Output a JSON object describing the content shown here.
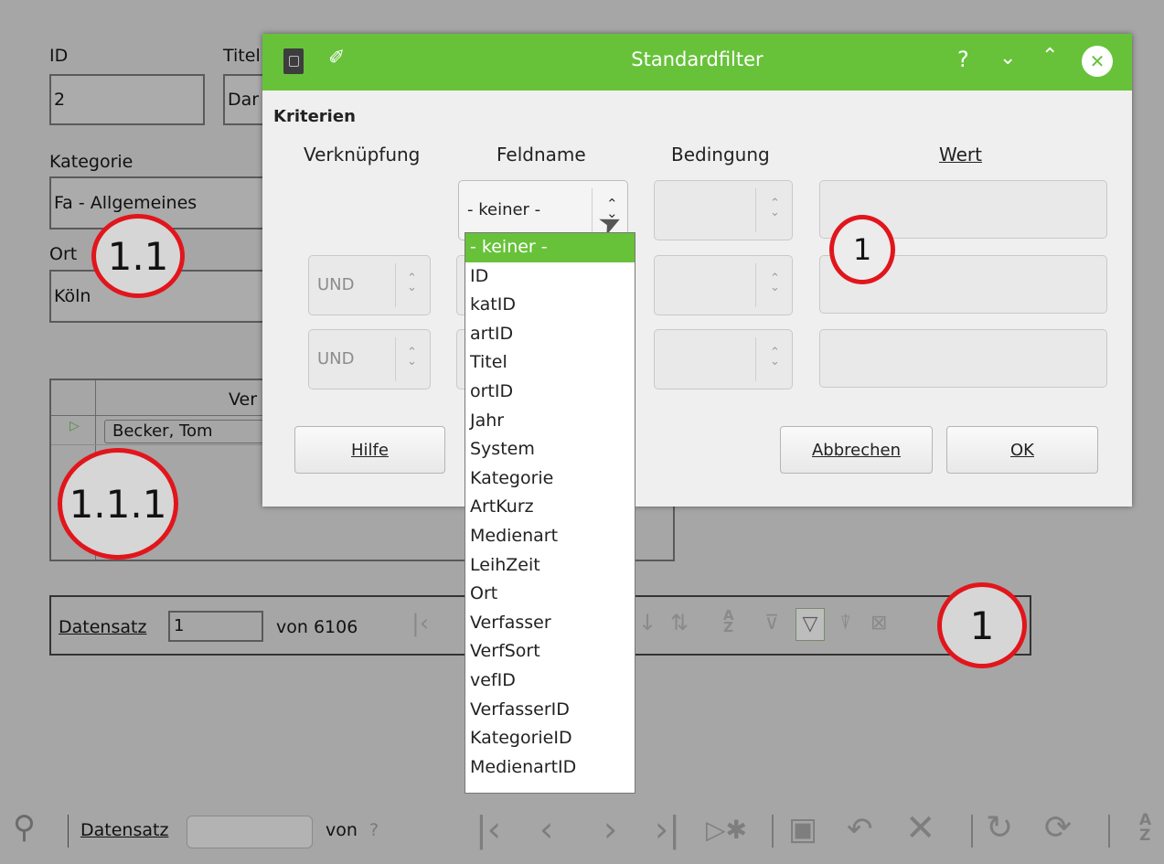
{
  "form": {
    "id_label": "ID",
    "id_value": "2",
    "titel_label": "Titel",
    "titel_value": "Dar",
    "kategorie_label": "Kategorie",
    "kategorie_value": "Fa - Allgemeines",
    "ort_label": "Ort",
    "ort_value": "Köln",
    "grid_header": "Ver",
    "grid_row_value": "Becker, Tom"
  },
  "annotations": {
    "a1": "1.1",
    "a2": "1.1.1",
    "a3": "1",
    "a4": "1"
  },
  "inner_nav": {
    "datensatz_label": "Datensatz",
    "record_value": "1",
    "of_label": "von 6106"
  },
  "bottom_toolbar": {
    "datensatz_label": "Datensatz",
    "record_value": "",
    "of_label": "von",
    "of_value": "?"
  },
  "dialog": {
    "title": "Standardfilter",
    "section_label": "Kriterien",
    "col_verknuepfung": "Verknüpfung",
    "col_feldname": "Feldname",
    "col_bedingung": "Bedingung",
    "col_wert": "Wert",
    "row1_field": "- keiner -",
    "row2_op": "UND",
    "row3_op": "UND",
    "help_button": "Hilfe",
    "cancel_button": "Abbrechen",
    "ok_button": "OK",
    "help_tb": "?"
  },
  "dropdown_items": [
    "- keiner -",
    "ID",
    "katID",
    "artID",
    "Titel",
    "ortID",
    "Jahr",
    "System",
    "Kategorie",
    "ArtKurz",
    "Medienart",
    "LeihZeit",
    "Ort",
    "Verfasser",
    "VerfSort",
    "vefID",
    "VerfasserID",
    "KategorieID",
    "MedienartID"
  ],
  "colors": {
    "accent": "#67c23a",
    "annotation_red": "#e1161c",
    "overlay_gray": "#a6a6a6"
  }
}
